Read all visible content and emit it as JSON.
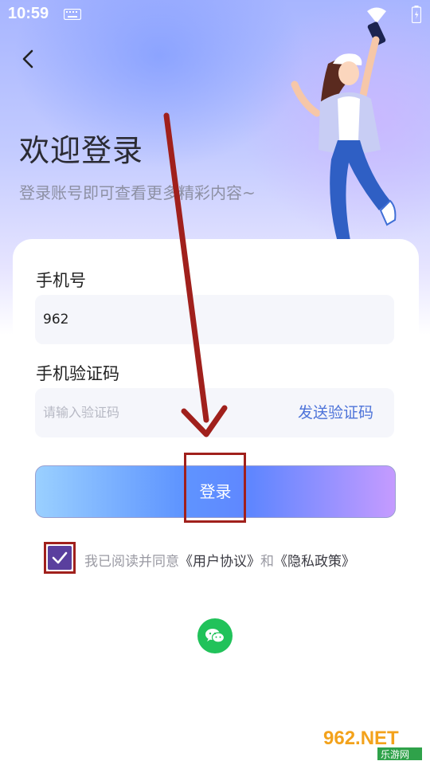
{
  "status_bar": {
    "time": "10:59"
  },
  "header": {
    "title": "欢迎登录",
    "subtitle": "登录账号即可查看更多精彩内容~"
  },
  "form": {
    "phone": {
      "label": "手机号",
      "value": "962"
    },
    "code": {
      "label": "手机验证码",
      "placeholder": "请输入验证码",
      "send_label": "发送验证码"
    },
    "login_label": "登录"
  },
  "agreement": {
    "checked": true,
    "prefix": "我已阅读并同意",
    "user_agreement": "《用户协议》",
    "connector": "和",
    "privacy_policy": "《隐私政策》"
  },
  "third_party": {
    "wechat_icon": "wechat-icon"
  },
  "watermark": {
    "text_top": "962.NET",
    "text_bottom": "乐游网"
  },
  "colors": {
    "accent_blue": "#4d73d9",
    "checkbox": "#5a3f9e",
    "wechat": "#21c25a",
    "annotation_red": "#a0201c"
  }
}
